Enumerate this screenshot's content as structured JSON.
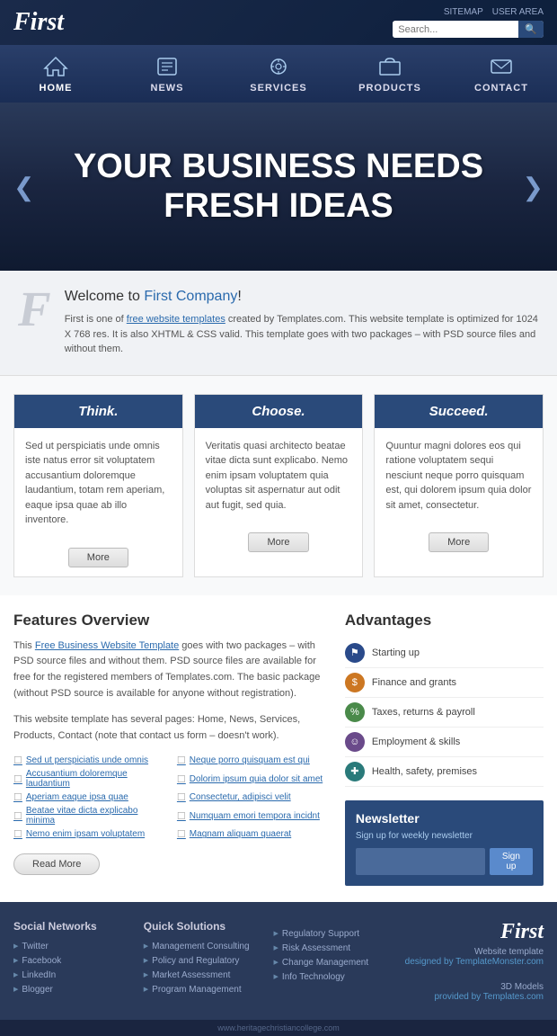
{
  "header": {
    "logo": "First",
    "links": [
      "SITEMAP",
      "USER AREA"
    ],
    "search_placeholder": "Search..."
  },
  "nav": {
    "items": [
      {
        "label": "HOME",
        "icon": "home"
      },
      {
        "label": "NEWS",
        "icon": "news"
      },
      {
        "label": "SERVICES",
        "icon": "services"
      },
      {
        "label": "PRODUCTS",
        "icon": "products"
      },
      {
        "label": "CONTACT",
        "icon": "contact"
      }
    ]
  },
  "hero": {
    "line1": "YOUR BUSINESS NEEDS",
    "line2": "FRESH IDEAS"
  },
  "welcome": {
    "letter": "F",
    "title_prefix": "Welcome to ",
    "title_highlight": "First Company",
    "title_suffix": "!",
    "text": "First is one of ",
    "link_text": "free website templates",
    "text2": " created by Templates.com. This website template is optimized for 1024 X 768 res. It is also XHTML & CSS valid. This template goes with two packages – with PSD source files and without them."
  },
  "cards": [
    {
      "title": "Think.",
      "body": "Sed ut perspiciatis unde omnis iste natus error sit voluptatem accusantium doloremque laudantium, totam rem aperiam, eaque ipsa quae ab illo inventore.",
      "button": "More"
    },
    {
      "title": "Choose.",
      "body": "Veritatis quasi architecto beatae vitae dicta sunt explicabo. Nemo enim ipsam voluptatem quia voluptas sit aspernatur aut odit aut fugit, sed quia.",
      "button": "More"
    },
    {
      "title": "Succeed.",
      "body": "Quuntur magni dolores eos qui ratione voluptatem sequi nesciunt neque porro quisquam est, qui dolorem ipsum quia dolor sit amet, consectetur.",
      "button": "More"
    }
  ],
  "features": {
    "title": "Features Overview",
    "text1": "This ",
    "link1": "Free Business Website Template",
    "text2": " goes with two packages – with PSD source files and without them. PSD source files are available for free for the registered members of Templates.com. The basic package (without PSD source is available for anyone without registration).",
    "text3": "This website template has several pages: Home, News, Services, Products, Contact (note that contact us form – doesn't work).",
    "list": [
      "Sed ut perspiciatis unde omnis",
      "Accusantium doloremque laudantium",
      "Aperiam eaque ipsa quae",
      "Beatae vitae dicta explicabo minima",
      "Nemo enim ipsam voluptatem",
      "Neque porro quisquam est qui",
      "Dolorim ipsum quia dolor sit amet",
      "Consectetur, adipisci velit",
      "Numquam emori tempora incidnt",
      "Magnam aliquam quaerat"
    ],
    "read_more": "Read More"
  },
  "advantages": {
    "title": "Advantages",
    "items": [
      {
        "label": "Starting up",
        "icon": "flag"
      },
      {
        "label": "Finance and grants",
        "icon": "dollar"
      },
      {
        "label": "Taxes, returns & payroll",
        "icon": "tax"
      },
      {
        "label": "Employment & skills",
        "icon": "people"
      },
      {
        "label": "Health, safety, premises",
        "icon": "health"
      }
    ]
  },
  "newsletter": {
    "title": "Newsletter",
    "subtitle": "Sign up for weekly newsletter",
    "button": "Sign up",
    "placeholder": ""
  },
  "footer": {
    "social": {
      "title": "Social Networks",
      "items": [
        "Twitter",
        "Facebook",
        "LinkedIn",
        "Blogger"
      ]
    },
    "solutions": {
      "title": "Quick Solutions",
      "items": [
        "Management Consulting",
        "Policy and Regulatory",
        "Market Assessment",
        "Program Management"
      ]
    },
    "other": {
      "title": "",
      "items": [
        "Regulatory Support",
        "Risk Assessment",
        "Change Management",
        "Info Technology"
      ]
    },
    "logo": "First",
    "logo_sub": "Website template",
    "designer": "designed by TemplateMonster.com",
    "models_label": "3D Models",
    "models_sub": "provided by Templates.com",
    "watermark": "www.heritagechristiancollege.com"
  }
}
